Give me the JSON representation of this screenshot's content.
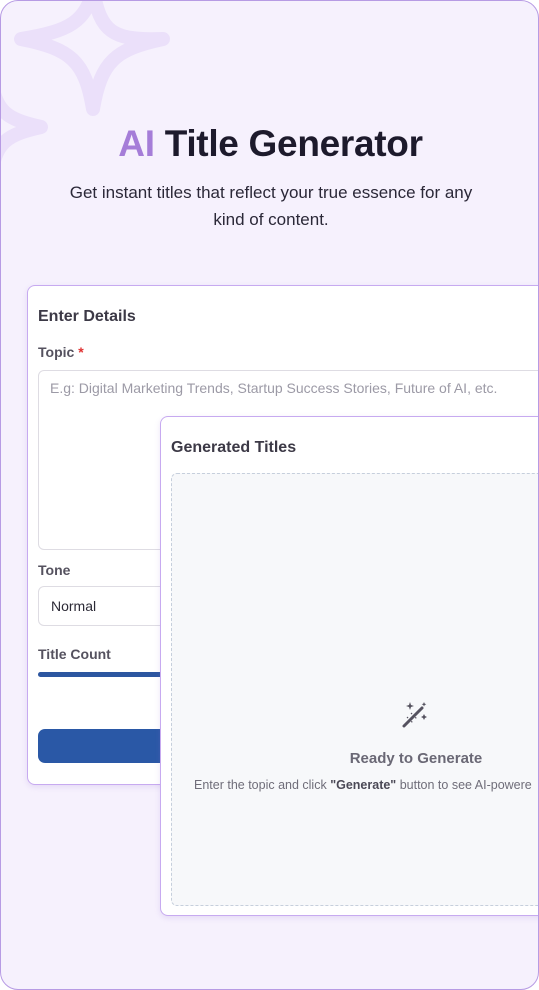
{
  "hero": {
    "title_accent": "AI",
    "title_rest": "Title Generator",
    "subtitle": "Get instant titles that reflect your true essence for any kind of content."
  },
  "details_card": {
    "title": "Enter Details",
    "topic_label": "Topic",
    "required_mark": "*",
    "topic_placeholder": "E.g: Digital Marketing Trends, Startup Success Stories, Future of AI, etc.",
    "tone_label": "Tone",
    "tone_value": "Normal",
    "title_count_label": "Title Count",
    "title_count_fill_fraction": 0.24,
    "generate_button_label": ""
  },
  "generated_card": {
    "title": "Generated Titles",
    "icon": "magic-wand-icon",
    "ready_heading": "Ready to Generate",
    "hint_prefix": "Enter the topic and click ",
    "hint_bold": "\"Generate\"",
    "hint_suffix": " button to see AI-powere"
  },
  "colors": {
    "accent_purple": "#a57dd8",
    "primary_blue": "#2a58a6",
    "background": "#f6f1fd",
    "border_purple": "#c7aaf0"
  }
}
